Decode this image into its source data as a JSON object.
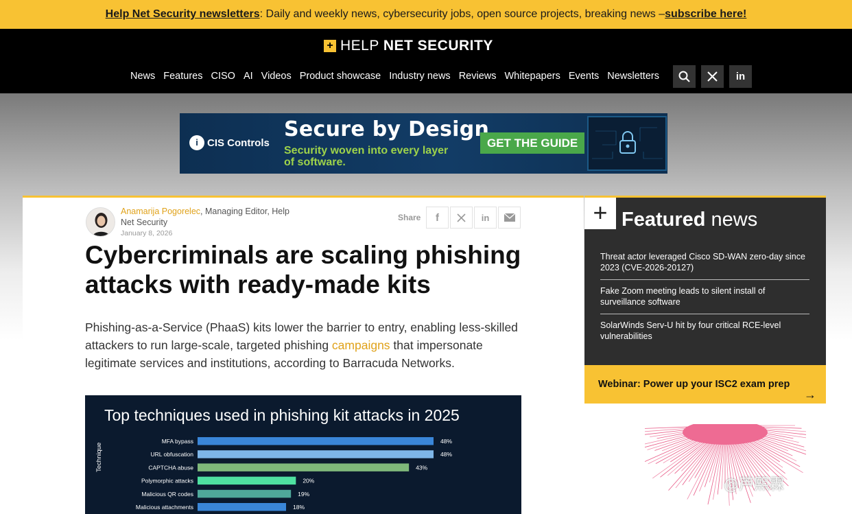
{
  "topbar": {
    "link_label": "Help Net Security newsletters",
    "message": ": Daily and weekly news, cybersecurity jobs, open source projects, breaking news – ",
    "cta_label": "subscribe here!"
  },
  "header": {
    "logo_mark": "+",
    "logo_thin": "HELP",
    "logo_bold": "NET SECURITY",
    "nav": [
      "News",
      "Features",
      "CISO",
      "AI",
      "Videos",
      "Product showcase",
      "Industry news",
      "Reviews",
      "Whitepapers",
      "Events",
      "Newsletters"
    ],
    "icons": [
      "search-icon",
      "x-icon",
      "linkedin-icon"
    ]
  },
  "banner": {
    "brand": "CIS Controls",
    "brand_mark": "i",
    "title": "Secure by Design",
    "subtitle": "Security woven into every layer of software.",
    "cta": "GET THE GUIDE"
  },
  "article": {
    "author": "Anamarija Pogorelec",
    "author_role": ", Managing Editor, Help Net Security",
    "date": "January 8, 2026",
    "share_label": "Share",
    "share_icons": [
      "facebook-icon",
      "x-icon",
      "linkedin-icon",
      "email-icon"
    ],
    "headline": "Cybercriminals are scaling phishing attacks with ready-made kits",
    "lede_before": "Phishing-as-a-Service (PhaaS) kits lower the barrier to entry, enabling less-skilled attackers to run large-scale, targeted phishing ",
    "lede_link": "campaigns",
    "lede_after": " that impersonate legitimate services and institutions, according to Barracuda Networks."
  },
  "chart_data": {
    "type": "bar",
    "orientation": "horizontal",
    "title": "Top techniques used in phishing kit attacks in 2025",
    "ylabel": "Technique",
    "categories": [
      "MFA bypass",
      "URL obfuscation",
      "CAPTCHA abuse",
      "Polymorphic attacks",
      "Malicious QR codes",
      "Malicious attachments"
    ],
    "values": [
      48,
      48,
      43,
      20,
      19,
      18
    ],
    "value_labels": [
      "48%",
      "48%",
      "43%",
      "20%",
      "19%",
      "18%"
    ],
    "colors": [
      "#3a86d8",
      "#7eb6e8",
      "#7fb87a",
      "#4ee0a0",
      "#4fa89a",
      "#3a86d8"
    ],
    "xlim": [
      0,
      50
    ]
  },
  "sidebar": {
    "featured_plus": "+",
    "featured_bold": "Featured",
    "featured_rest": " news",
    "items": [
      "Threat actor leveraged Cisco SD-WAN zero-day since 2023 (CVE-2026-20127)",
      "Fake Zoom meeting leads to silent install of surveillance software",
      "SolarWinds Serv-U hit by four critical RCE-level vulnerabilities"
    ],
    "webinar_label": "Webinar: Power up your ISC2 exam prep",
    "webinar_arrow": "→"
  },
  "watermark": "@芦熙霖",
  "colors": {
    "accent_yellow": "#f8c233",
    "header_bg": "#000000",
    "sidebar_bg": "#2e2e2e",
    "link_orange": "#e0a21a"
  }
}
